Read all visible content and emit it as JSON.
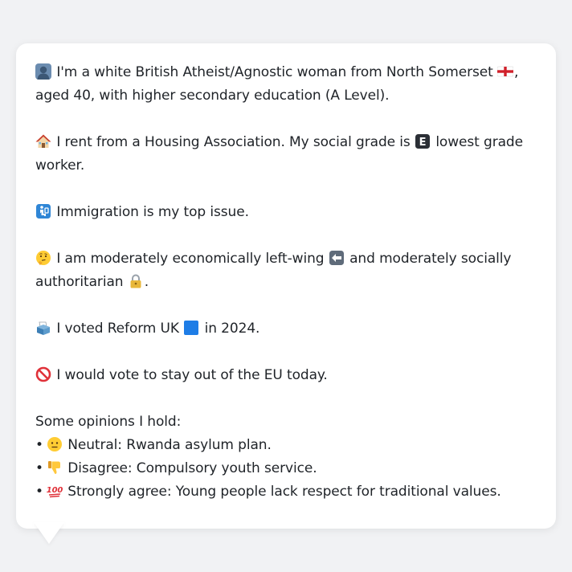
{
  "message": {
    "intro_part1": "I'm a white British Atheist/Agnostic woman from North Somerset",
    "intro_part2": ", aged 40, with higher secondary education (A Level).",
    "housing_part1": "I rent from a Housing Association. My social grade is",
    "housing_part2": "lowest grade worker.",
    "grade_letter": "E",
    "top_issue": "Immigration is my top issue.",
    "politics_part1": "I am moderately economically left-wing",
    "politics_part2": "and moderately socially authoritarian",
    "politics_end": ".",
    "vote_part1": "I voted Reform UK",
    "vote_part2": "in 2024.",
    "eu": "I would vote to stay out of the EU today.",
    "opinions_heading": "Some opinions I hold:",
    "bullet_char": "•",
    "opinions": [
      {
        "icon": "neutral-face-icon",
        "text": "Neutral: Rwanda asylum plan."
      },
      {
        "icon": "thumbs-down-icon",
        "text": "Disagree: Compulsory youth service."
      },
      {
        "icon": "hundred-points-icon",
        "text": "Strongly agree: Young people lack respect for traditional values."
      }
    ]
  },
  "icons": {
    "person": "person-silhouette-icon",
    "flag": "england-flag-icon",
    "house": "house-icon",
    "grade": "letter-e-icon",
    "immigration": "passport-control-icon",
    "thinking": "thinking-face-icon",
    "left_arrow": "left-arrow-icon",
    "lock": "lock-icon",
    "ballot": "ballot-box-icon",
    "blue_square": "blue-square-icon",
    "no_entry": "prohibited-icon"
  },
  "colors": {
    "background": "#f1f2f4",
    "card": "#ffffff",
    "text": "#1f2328",
    "reform_blue": "#1e7de6",
    "prohibited_red": "#e0323a"
  }
}
